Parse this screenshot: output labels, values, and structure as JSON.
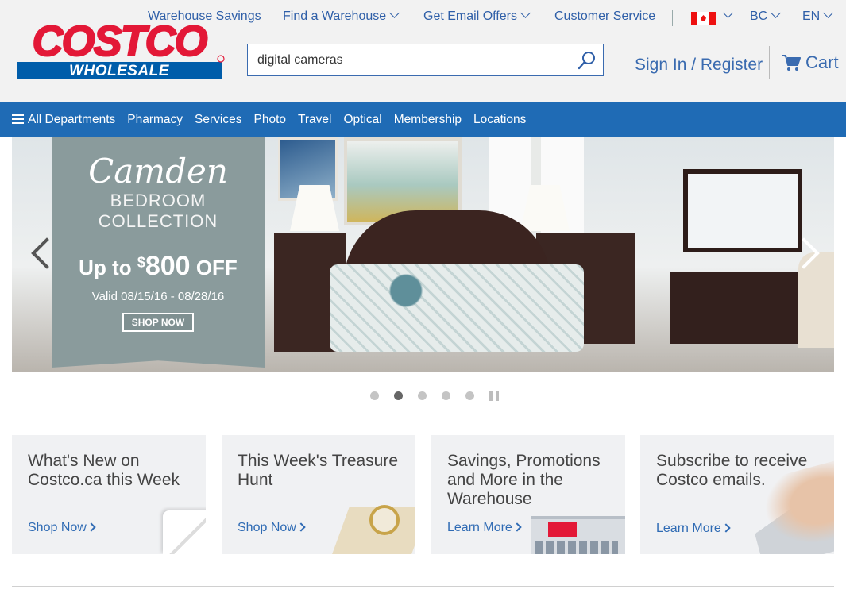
{
  "header": {
    "logo": {
      "top": "COSTCO",
      "bottom": "WHOLESALE"
    },
    "util_links": {
      "warehouse_savings": "Warehouse Savings",
      "find_warehouse": "Find a Warehouse",
      "email_offers": "Get Email Offers",
      "customer_service": "Customer Service",
      "province": "BC",
      "language": "EN"
    },
    "search": {
      "value": "digital cameras"
    },
    "signin": "Sign In / Register",
    "cart": "Cart"
  },
  "nav": {
    "items": [
      "All Departments",
      "Pharmacy",
      "Services",
      "Photo",
      "Travel",
      "Optical",
      "Membership",
      "Locations"
    ]
  },
  "hero": {
    "title": "Camden",
    "subtitle_line1": "BEDROOM",
    "subtitle_line2": "COLLECTION",
    "offer_prefix": "Up to",
    "offer_currency": "$",
    "offer_amount": "800",
    "offer_suffix": "OFF",
    "valid": "Valid 08/15/16 - 08/28/16",
    "cta": "SHOP NOW"
  },
  "carousel": {
    "dot_count": 5,
    "active_index": 1
  },
  "tiles": [
    {
      "title": "What's New on Costco.ca this Week",
      "cta": "Shop Now"
    },
    {
      "title": "This Week's Treasure Hunt",
      "cta": "Shop Now"
    },
    {
      "title": "Savings, Promotions and More in the Warehouse",
      "cta": "Learn More"
    },
    {
      "title": "Subscribe to receive Costco emails.",
      "cta": "Learn More"
    }
  ],
  "colors": {
    "brand_red": "#e31837",
    "brand_blue": "#005daa",
    "nav_blue": "#1f6bb5",
    "link_blue": "#2f6bb4"
  },
  "icons": [
    "search-icon",
    "cart-icon",
    "hamburger-icon",
    "chevron-down-icon",
    "chevron-right-icon",
    "canada-flag-icon",
    "pause-icon"
  ]
}
